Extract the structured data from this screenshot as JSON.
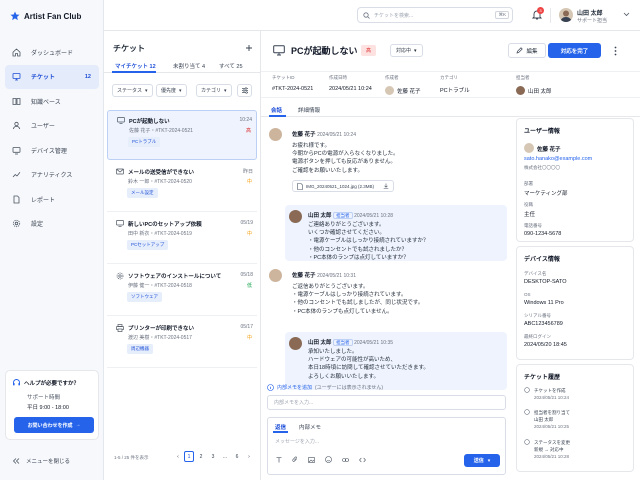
{
  "brand": {
    "name": "Artist Fan Club"
  },
  "nav": {
    "items": [
      {
        "label": "ダッシュボード",
        "icon": "home-icon"
      },
      {
        "label": "チケット",
        "icon": "ticket-icon",
        "count": "12",
        "active": true
      },
      {
        "label": "知識ベース",
        "icon": "book-icon"
      },
      {
        "label": "ユーザー",
        "icon": "user-icon"
      },
      {
        "label": "デバイス管理",
        "icon": "monitor-icon"
      },
      {
        "label": "アナリティクス",
        "icon": "analytics-icon"
      },
      {
        "label": "レポート",
        "icon": "report-icon"
      },
      {
        "label": "設定",
        "icon": "gear-icon"
      }
    ]
  },
  "help": {
    "title": "ヘルプが必要ですか？",
    "support_label": "サポート時間",
    "hours": "平日 9:00 - 18:00",
    "button": "お問い合わせを作成"
  },
  "sidebar_footer": {
    "collapse": "メニューを閉じる"
  },
  "topbar": {
    "search_placeholder": "チケットを検索...",
    "shortcut": "⌘K",
    "notifications": "3",
    "user_name": "山田 太郎",
    "user_role": "サポート担当"
  },
  "ticket_list": {
    "title": "チケット",
    "tabs": [
      "マイチケット 12",
      "未割り当て 4",
      "すべて 25"
    ],
    "filters": [
      "ステータス",
      "優先度",
      "カテゴリ"
    ],
    "items": [
      {
        "title": "PCが起動しない",
        "date": "10:24",
        "meta": "佐藤 花子・#TKT-2024-0521",
        "tag": "PCトラブル",
        "priority": "高",
        "priority_color": "#dc2626"
      },
      {
        "title": "メールの送受信ができない",
        "date": "昨日",
        "meta": "鈴木 一郎・#TKT-2024-0520",
        "tag": "メール設定",
        "priority": "中",
        "priority_color": "#f59e0b"
      },
      {
        "title": "新しいPCのセットアップ依頼",
        "date": "05/19",
        "meta": "田中 新衣・#TKT-2024-0519",
        "tag": "PCセットアップ",
        "priority": "中",
        "priority_color": "#f59e0b"
      },
      {
        "title": "ソフトウェアのインストールについて",
        "date": "05/18",
        "meta": "伊藤 健一・#TKT-2024-0518",
        "tag": "ソフトウェア",
        "priority": "低",
        "priority_color": "#16a34a"
      },
      {
        "title": "プリンターが印刷できない",
        "date": "05/17",
        "meta": "渡辺 美樹・#TKT-2024-0517",
        "tag": "周辺機器",
        "priority": "中",
        "priority_color": "#f59e0b"
      }
    ],
    "pagination": {
      "info": "1-5 / 25 件を表示",
      "pages": [
        "1",
        "2",
        "3",
        "...",
        "6"
      ]
    }
  },
  "ticket": {
    "title": "PCが起動しない",
    "priority": "高",
    "status": "対応中",
    "edit": "編集",
    "complete": "対応を完了",
    "meta": [
      {
        "label": "チケットID",
        "value": "#TKT-2024-0521"
      },
      {
        "label": "作成日時",
        "value": "2024/05/21 10:24"
      },
      {
        "label": "作成者",
        "value": "佐藤 花子"
      },
      {
        "label": "カテゴリ",
        "value": "PCトラブル"
      },
      {
        "label": "担当者",
        "value": "山田 太郎"
      }
    ],
    "tabs": [
      "会話",
      "詳細情報"
    ]
  },
  "conversation": {
    "messages": [
      {
        "name": "佐藤 花子",
        "date": "2024/05/21 10:24",
        "lines": [
          "お疲れ様です。",
          "今朝からPCの電源が入らなくなりました。",
          "電源ボタンを押しても反応がありません。",
          "ご確認をお願いいたします。"
        ],
        "attachment": "IMG_20240521_1024.jpg (2.3MB)"
      },
      {
        "name": "山田 太郎",
        "tag": "担当者",
        "date": "2024/05/21 10:28",
        "lines": [
          "ご連絡ありがとうございます。",
          "いくつか確認させてください。",
          "・電源ケーブルはしっかり接続されていますか？",
          "・他のコンセントでも試されましたか？",
          "・PC本体のランプは点灯していますか？"
        ]
      },
      {
        "name": "佐藤 花子",
        "date": "2024/05/21 10:31",
        "lines": [
          "ご返信ありがとうございます。",
          "・電源ケーブルはしっかり接続されています。",
          "・他のコンセントでも試しましたが、同じ状況です。",
          "・PC本体のランプも点灯していません。"
        ]
      },
      {
        "name": "山田 太郎",
        "tag": "担当者",
        "date": "2024/05/21 10:35",
        "lines": [
          "承知いたしました。",
          "ハードウェアの可能性が高いため、",
          "本日18時頃に訪問して確認させていただきます。",
          "よろしくお願いいたします。"
        ]
      }
    ],
    "note_hint": "内部メモを追加",
    "note_hint_sub": "(ユーザーには表示されません)",
    "note_placeholder": "内部メモを入力...",
    "reply_tabs": [
      "返信",
      "内部メモ"
    ],
    "reply_placeholder": "メッセージを入力...",
    "send": "送信"
  },
  "user_info": {
    "title": "ユーザー情報",
    "name": "佐藤 花子",
    "email": "sato.hanako@example.com",
    "company": "株式会社〇〇〇〇",
    "dept_label": "部署",
    "dept": "マーケティング部",
    "role_label": "役職",
    "role": "主任",
    "phone_label": "電話番号",
    "phone": "090-1234-5678"
  },
  "device_info": {
    "title": "デバイス情報",
    "name_label": "デバイス名",
    "name": "DESKTOP-SATO",
    "os_label": "OS",
    "os": "Windows 11 Pro",
    "serial_label": "シリアル番号",
    "serial": "ABC123456789",
    "last_label": "最終ログイン",
    "last": "2024/05/20 18:45"
  },
  "history": {
    "title": "チケット履歴",
    "events": [
      {
        "label": "チケットを作成",
        "date": "2024/05/21 10:24"
      },
      {
        "label": "担当者を割り当て",
        "value": "山田 太郎",
        "date": "2024/05/21 10:25"
      },
      {
        "label": "ステータスを変更",
        "value": "新規 → 対応中",
        "date": "2024/05/21 10:28"
      }
    ]
  },
  "colors": {
    "accent": "#2563eb",
    "priority_high": "#dc2626"
  }
}
